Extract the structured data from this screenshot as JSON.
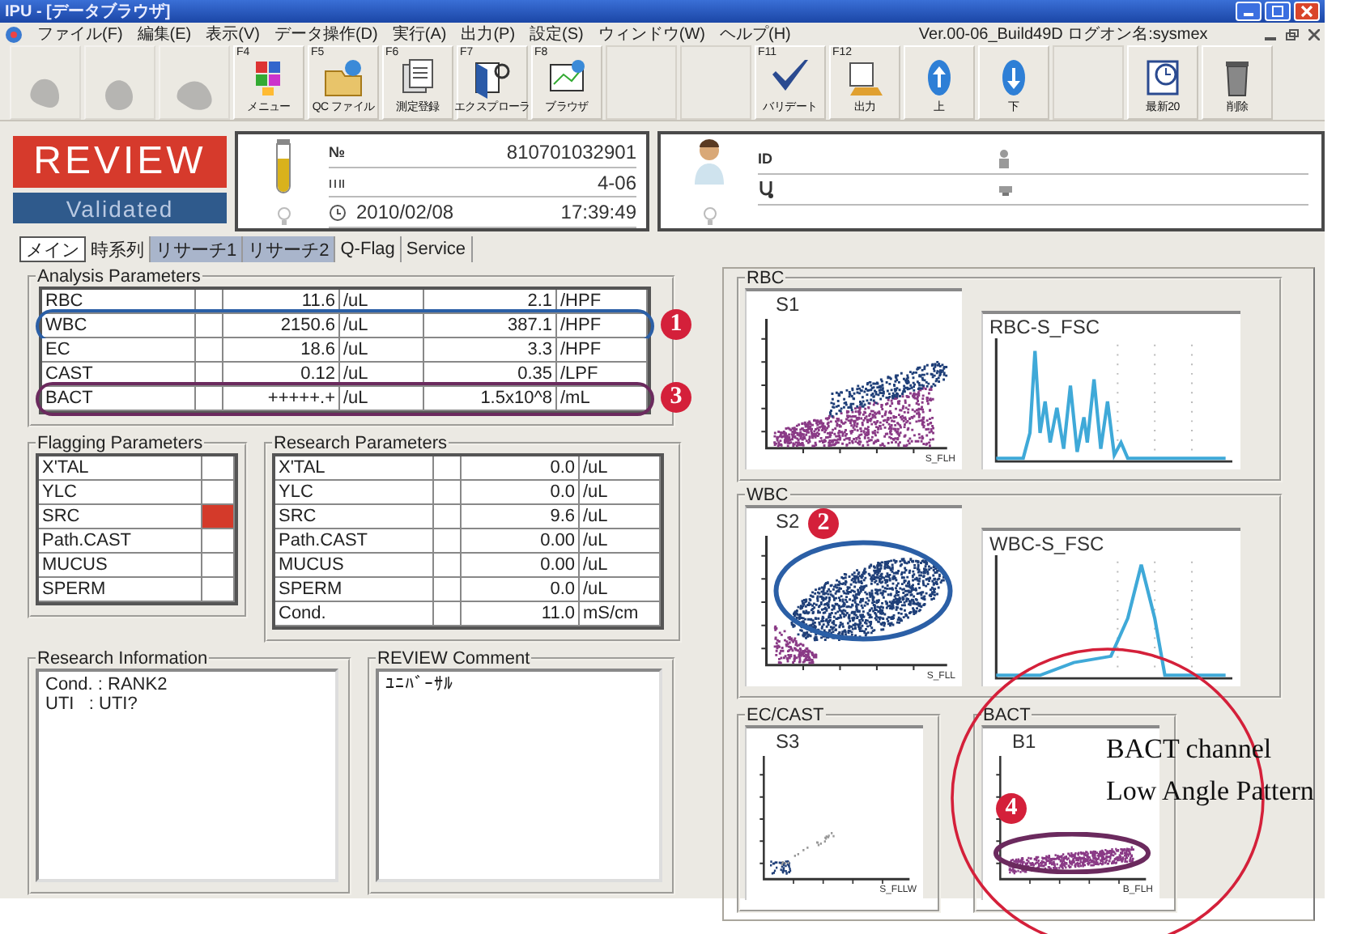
{
  "window": {
    "title": "IPU - [データブラウザ]"
  },
  "menu": [
    "ファイル(F)",
    "編集(E)",
    "表示(V)",
    "データ操作(D)",
    "実行(A)",
    "出力(P)",
    "設定(S)",
    "ウィンドウ(W)",
    "ヘルプ(H)"
  ],
  "version": "Ver.00-06_Build49D ログオン名:sysmex",
  "toolbar": {
    "items": [
      {
        "kind": "button",
        "disabled": true
      },
      {
        "kind": "button",
        "disabled": true
      },
      {
        "kind": "button",
        "disabled": true
      },
      {
        "kind": "button",
        "key": "F4",
        "label": "メニュー",
        "disabled": false
      },
      {
        "kind": "button",
        "key": "F5",
        "label": "QC ファイル",
        "disabled": false
      },
      {
        "kind": "button",
        "key": "F6",
        "label": "測定登録",
        "disabled": false
      },
      {
        "kind": "button",
        "key": "F7",
        "label": "エクスプローラ",
        "disabled": false
      },
      {
        "kind": "button",
        "key": "F8",
        "label": "ブラウザ",
        "disabled": false
      },
      {
        "kind": "spacer"
      },
      {
        "kind": "spacer"
      },
      {
        "kind": "button",
        "key": "F11",
        "label": "バリデート",
        "disabled": false
      },
      {
        "kind": "button",
        "key": "F12",
        "label": "出力",
        "disabled": false
      },
      {
        "kind": "button",
        "label": "上",
        "disabled": false
      },
      {
        "kind": "button",
        "label": "下",
        "disabled": false
      },
      {
        "kind": "spacer"
      },
      {
        "kind": "button",
        "label": "最新20",
        "disabled": false
      },
      {
        "kind": "button",
        "label": "削除",
        "disabled": false
      }
    ]
  },
  "status": {
    "review": "REVIEW",
    "validated": "Validated"
  },
  "sample": {
    "number_label": "№",
    "number": "810701032901",
    "rack": "4-06",
    "date": "2010/02/08",
    "time": "17:39:49"
  },
  "patient": {
    "id_label": "ID"
  },
  "tabs": [
    {
      "label": "メイン",
      "selected": true,
      "highlighted": false
    },
    {
      "label": "時系列",
      "selected": false,
      "highlighted": false
    },
    {
      "label": "リサーチ1",
      "selected": false,
      "highlighted": true
    },
    {
      "label": "リサーチ2",
      "selected": false,
      "highlighted": true
    },
    {
      "label": "Q-Flag",
      "selected": false,
      "highlighted": false
    },
    {
      "label": "Service",
      "selected": false,
      "highlighted": false
    }
  ],
  "analysis": {
    "title": "Analysis Parameters",
    "rows": [
      {
        "name": "RBC",
        "value": "11.6",
        "unit": "/uL",
        "value2": "2.1",
        "unit2": "/HPF"
      },
      {
        "name": "WBC",
        "value": "2150.6",
        "unit": "/uL",
        "value2": "387.1",
        "unit2": "/HPF",
        "ring": {
          "number": "1",
          "color": "#2b5fa6"
        }
      },
      {
        "name": "EC",
        "value": "18.6",
        "unit": "/uL",
        "value2": "3.3",
        "unit2": "/HPF"
      },
      {
        "name": "CAST",
        "value": "0.12",
        "unit": "/uL",
        "value2": "0.35",
        "unit2": "/LPF"
      },
      {
        "name": "BACT",
        "value": "+++++.+",
        "unit": "/uL",
        "value2": "1.5x10^8",
        "unit2": "/mL",
        "ring": {
          "number": "3",
          "color": "#6b2a5e"
        }
      }
    ]
  },
  "flagging": {
    "title": "Flagging Parameters",
    "rows": [
      {
        "name": "X'TAL",
        "flagged": false
      },
      {
        "name": "YLC",
        "flagged": false
      },
      {
        "name": "SRC",
        "flagged": true
      },
      {
        "name": "Path.CAST",
        "flagged": false
      },
      {
        "name": "MUCUS",
        "flagged": false
      },
      {
        "name": "SPERM",
        "flagged": false
      }
    ]
  },
  "research": {
    "title": "Research Parameters",
    "rows": [
      {
        "name": "X'TAL",
        "value": "0.0",
        "unit": "/uL"
      },
      {
        "name": "YLC",
        "value": "0.0",
        "unit": "/uL"
      },
      {
        "name": "SRC",
        "value": "9.6",
        "unit": "/uL"
      },
      {
        "name": "Path.CAST",
        "value": "0.00",
        "unit": "/uL"
      },
      {
        "name": "MUCUS",
        "value": "0.00",
        "unit": "/uL"
      },
      {
        "name": "SPERM",
        "value": "0.0",
        "unit": "/uL"
      },
      {
        "name": "Cond.",
        "value": "11.0",
        "unit": "mS/cm"
      }
    ]
  },
  "research_info": {
    "title": "Research Information",
    "lines": [
      "Cond. : RANK2",
      "UTI   : UTI?"
    ]
  },
  "review_comment": {
    "title": "REVIEW Comment",
    "text": "ﾕﾆﾊﾞｰｻﾙ"
  },
  "scattergrams": {
    "rows": [
      {
        "title": "RBC",
        "scatter": {
          "kind": "rbc",
          "label": "S1",
          "xlabel": "S_FLH"
        },
        "histogram": {
          "kind": "multi",
          "label": "RBC-S_FSC"
        }
      },
      {
        "title": "WBC",
        "scatter": {
          "kind": "wbc",
          "label": "S2",
          "xlabel": "S_FLL",
          "ring": {
            "number": "2",
            "color": "#2b5fa6"
          }
        },
        "histogram": {
          "kind": "single",
          "label": "WBC-S_FSC"
        }
      }
    ],
    "bottom": [
      {
        "title": "EC/CAST",
        "scatter": {
          "kind": "ec",
          "label": "S3",
          "xlabel": "S_FLLW"
        }
      },
      {
        "title": "BACT",
        "scatter": {
          "kind": "bact",
          "label": "B1",
          "xlabel": "B_FLH",
          "ring": {
            "number": "4",
            "color": "#6b2a5e"
          }
        }
      }
    ]
  },
  "callout": {
    "lines": [
      "BACT channel",
      "Low Angle Pattern"
    ],
    "color": "#d4203a"
  }
}
